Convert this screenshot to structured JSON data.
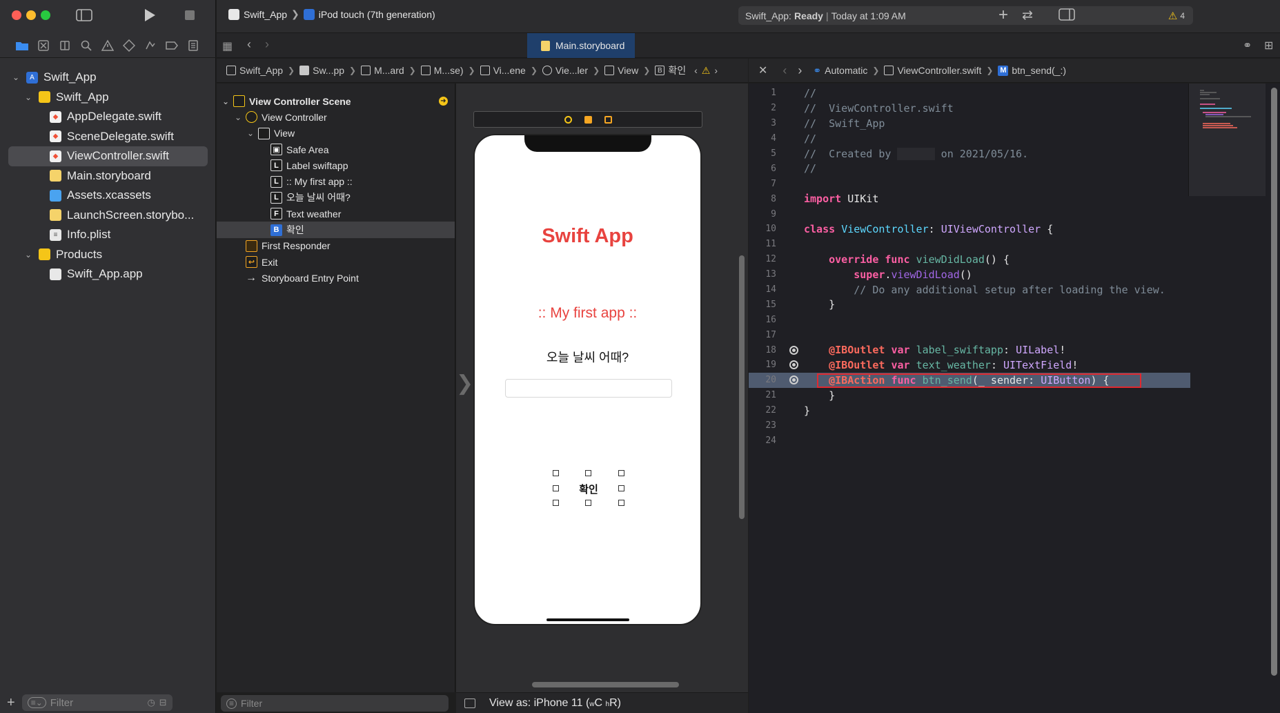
{
  "window": {
    "traffic_colors": [
      "#fe5f57",
      "#febc2e",
      "#28c840"
    ]
  },
  "toolbar": {
    "scheme": "Swift_App",
    "destination": "iPod touch (7th generation)",
    "status_app": "Swift_App:",
    "status_state": "Ready",
    "status_sep": "|",
    "status_time": "Today at 1:09 AM",
    "warning_count": "4"
  },
  "tabs": {
    "active_tab": "Main.storyboard"
  },
  "navigator": {
    "items": [
      {
        "label": "Swift_App",
        "level": 0,
        "kind": "project",
        "disclosure": "v"
      },
      {
        "label": "Swift_App",
        "level": 1,
        "kind": "folder",
        "disclosure": "v"
      },
      {
        "label": "AppDelegate.swift",
        "level": 2,
        "kind": "swift"
      },
      {
        "label": "SceneDelegate.swift",
        "level": 2,
        "kind": "swift"
      },
      {
        "label": "ViewController.swift",
        "level": 2,
        "kind": "swift",
        "selected": true
      },
      {
        "label": "Main.storyboard",
        "level": 2,
        "kind": "storyboard"
      },
      {
        "label": "Assets.xcassets",
        "level": 2,
        "kind": "assets"
      },
      {
        "label": "LaunchScreen.storybo...",
        "level": 2,
        "kind": "storyboard"
      },
      {
        "label": "Info.plist",
        "level": 2,
        "kind": "plist"
      },
      {
        "label": "Products",
        "level": 1,
        "kind": "folder",
        "disclosure": "v"
      },
      {
        "label": "Swift_App.app",
        "level": 2,
        "kind": "app"
      }
    ],
    "filter_placeholder": "Filter"
  },
  "storyboard_jumpbar": {
    "items": [
      "Swift_App",
      "Sw...pp",
      "M...ard",
      "M...se)",
      "Vi...ene",
      "Vie...ler",
      "View",
      "확인"
    ],
    "last_badge": "B"
  },
  "outline": {
    "items": [
      {
        "label": "View Controller Scene",
        "level": 0,
        "icon": "scene",
        "bold": true,
        "disclosure": "v"
      },
      {
        "label": "View Controller",
        "level": 1,
        "icon": "vc",
        "disclosure": "v"
      },
      {
        "label": "View",
        "level": 2,
        "icon": "view",
        "disclosure": "v"
      },
      {
        "label": "Safe Area",
        "level": 3,
        "icon": "safe"
      },
      {
        "label": "Label swiftapp",
        "level": 3,
        "icon": "L"
      },
      {
        "label": ":: My first app ::",
        "level": 3,
        "icon": "L"
      },
      {
        "label": "오늘 날씨 어때?",
        "level": 3,
        "icon": "L"
      },
      {
        "label": "Text weather",
        "level": 3,
        "icon": "F"
      },
      {
        "label": "확인",
        "level": 3,
        "icon": "B",
        "selected": true
      },
      {
        "label": "First Responder",
        "level": 1,
        "icon": "responder"
      },
      {
        "label": "Exit",
        "level": 1,
        "icon": "exit"
      },
      {
        "label": "Storyboard Entry Point",
        "level": 1,
        "icon": "arrow"
      }
    ],
    "filter_placeholder": "Filter"
  },
  "canvas": {
    "app_title": "Swift App",
    "app_subtitle": ":: My first app ::",
    "app_question": "오늘 날씨 어때?",
    "app_button": "확인",
    "footer_prefix": "View as: iPhone 11 (",
    "footer_w": "w",
    "footer_c": "C",
    "footer_h": "h",
    "footer_r": "R",
    "footer_close": ")"
  },
  "editor_jumpbar": {
    "mode": "Automatic",
    "file": "ViewController.swift",
    "symbol_badge": "M",
    "symbol": "btn_send(_:)"
  },
  "code": {
    "lines": [
      {
        "n": "1",
        "tokens": [
          {
            "t": "//",
            "c": "cm"
          }
        ]
      },
      {
        "n": "2",
        "tokens": [
          {
            "t": "//  ViewController.swift",
            "c": "cm"
          }
        ]
      },
      {
        "n": "3",
        "tokens": [
          {
            "t": "//  Swift_App",
            "c": "cm"
          }
        ]
      },
      {
        "n": "4",
        "tokens": [
          {
            "t": "//",
            "c": "cm"
          }
        ]
      },
      {
        "n": "5",
        "tokens": [
          {
            "t": "//  Created by ",
            "c": "cm"
          },
          {
            "t": "      ",
            "c": "redact"
          },
          {
            "t": " on 2021/05/16.",
            "c": "cm"
          }
        ]
      },
      {
        "n": "6",
        "tokens": [
          {
            "t": "//",
            "c": "cm"
          }
        ]
      },
      {
        "n": "7",
        "tokens": []
      },
      {
        "n": "8",
        "tokens": [
          {
            "t": "import",
            "c": "kw"
          },
          {
            "t": " UIKit",
            "c": "ct"
          }
        ]
      },
      {
        "n": "9",
        "tokens": []
      },
      {
        "n": "10",
        "tokens": [
          {
            "t": "class",
            "c": "kw"
          },
          {
            "t": " ",
            "c": "ct"
          },
          {
            "t": "ViewController",
            "c": "ty"
          },
          {
            "t": ": ",
            "c": "ct"
          },
          {
            "t": "UIViewController",
            "c": "ty2"
          },
          {
            "t": " {",
            "c": "ct"
          }
        ]
      },
      {
        "n": "11",
        "tokens": []
      },
      {
        "n": "12",
        "tokens": [
          {
            "t": "    ",
            "c": "ct"
          },
          {
            "t": "override",
            "c": "kw"
          },
          {
            "t": " ",
            "c": "ct"
          },
          {
            "t": "func",
            "c": "kw"
          },
          {
            "t": " ",
            "c": "ct"
          },
          {
            "t": "viewDidLoad",
            "c": "fn"
          },
          {
            "t": "() {",
            "c": "ct"
          }
        ]
      },
      {
        "n": "13",
        "tokens": [
          {
            "t": "        ",
            "c": "ct"
          },
          {
            "t": "super",
            "c": "kw"
          },
          {
            "t": ".",
            "c": "ct"
          },
          {
            "t": "viewDidLoad",
            "c": "mt"
          },
          {
            "t": "()",
            "c": "ct"
          }
        ]
      },
      {
        "n": "14",
        "tokens": [
          {
            "t": "        // Do any additional setup after loading the view.",
            "c": "cm"
          }
        ]
      },
      {
        "n": "15",
        "tokens": [
          {
            "t": "    }",
            "c": "ct"
          }
        ]
      },
      {
        "n": "16",
        "tokens": []
      },
      {
        "n": "17",
        "tokens": []
      },
      {
        "n": "18",
        "connected": true,
        "tokens": [
          {
            "t": "    ",
            "c": "ct"
          },
          {
            "t": "@IBOutlet",
            "c": "at"
          },
          {
            "t": " ",
            "c": "ct"
          },
          {
            "t": "var",
            "c": "kw"
          },
          {
            "t": " ",
            "c": "ct"
          },
          {
            "t": "label_swiftapp",
            "c": "fn"
          },
          {
            "t": ": ",
            "c": "ct"
          },
          {
            "t": "UILabel",
            "c": "ty2"
          },
          {
            "t": "!",
            "c": "ct"
          }
        ]
      },
      {
        "n": "19",
        "connected": true,
        "tokens": [
          {
            "t": "    ",
            "c": "ct"
          },
          {
            "t": "@IBOutlet",
            "c": "at"
          },
          {
            "t": " ",
            "c": "ct"
          },
          {
            "t": "var",
            "c": "kw"
          },
          {
            "t": " ",
            "c": "ct"
          },
          {
            "t": "text_weather",
            "c": "fn"
          },
          {
            "t": ": ",
            "c": "ct"
          },
          {
            "t": "UITextField",
            "c": "ty2"
          },
          {
            "t": "!",
            "c": "ct"
          }
        ]
      },
      {
        "n": "20",
        "connected": true,
        "highlight": true,
        "tokens": [
          {
            "t": "    ",
            "c": "ct"
          },
          {
            "t": "@IBAction",
            "c": "at"
          },
          {
            "t": " ",
            "c": "ct"
          },
          {
            "t": "func",
            "c": "kw"
          },
          {
            "t": " ",
            "c": "ct"
          },
          {
            "t": "btn_send",
            "c": "fn"
          },
          {
            "t": "(_ sender: ",
            "c": "ct"
          },
          {
            "t": "UIButton",
            "c": "ty2"
          },
          {
            "t": ") {",
            "c": "ct"
          }
        ]
      },
      {
        "n": "21",
        "tokens": [
          {
            "t": "    }",
            "c": "ct"
          }
        ]
      },
      {
        "n": "22",
        "tokens": [
          {
            "t": "}",
            "c": "ct"
          }
        ]
      },
      {
        "n": "23",
        "tokens": []
      },
      {
        "n": "24",
        "tokens": []
      }
    ]
  },
  "colors": {
    "accent": "#3a8cf0",
    "app_red": "#e8433f",
    "highlight_box": "#e0292f",
    "warning": "#f5c518"
  }
}
